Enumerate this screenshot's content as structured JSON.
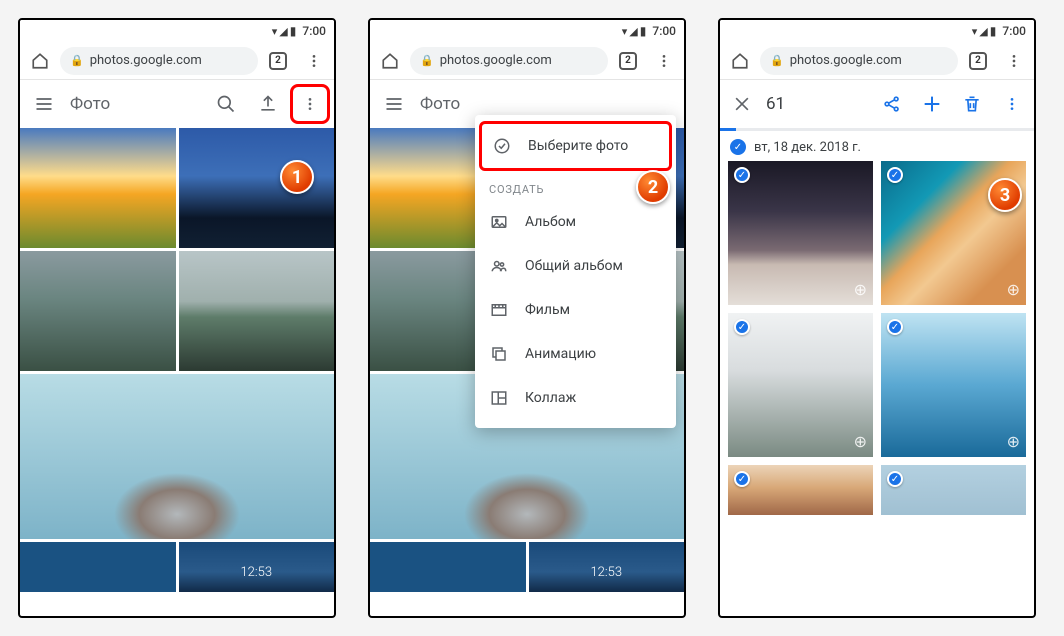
{
  "status": {
    "time": "7:00"
  },
  "browser": {
    "url": "photos.google.com",
    "tab_count": "2"
  },
  "app_bar": {
    "title": "Фото"
  },
  "menu": {
    "select": "Выберите фото",
    "section_create": "СОЗДАТЬ",
    "album": "Альбом",
    "shared_album": "Общий альбом",
    "movie": "Фильм",
    "animation": "Анимацию",
    "collage": "Коллаж"
  },
  "selection": {
    "count": "61",
    "date": "вт, 18 дек. 2018 г."
  },
  "badges": {
    "b1": "1",
    "b2": "2",
    "b3": "3"
  }
}
